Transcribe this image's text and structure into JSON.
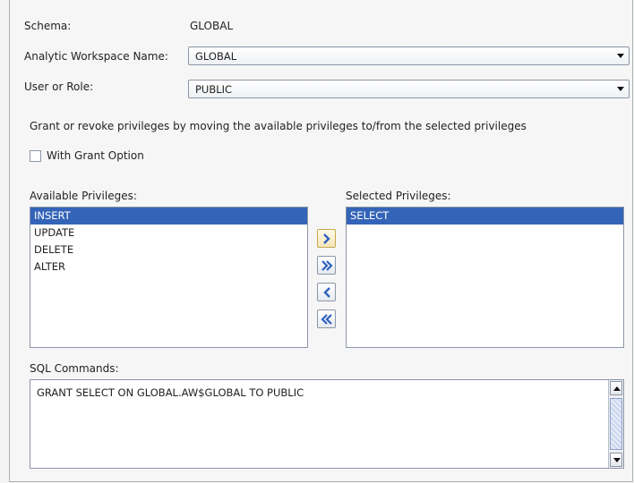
{
  "schema": {
    "label": "Schema:",
    "value": "GLOBAL"
  },
  "aw": {
    "label": "Analytic Workspace Name:",
    "value": "GLOBAL"
  },
  "role": {
    "label": "User or Role:",
    "value": "PUBLIC"
  },
  "instructions": "Grant or revoke privileges by moving the available privileges to/from the selected privileges",
  "grant_option": {
    "label": "With Grant Option",
    "checked": false
  },
  "available": {
    "label": "Available Privileges:",
    "items": [
      "INSERT",
      "UPDATE",
      "DELETE",
      "ALTER"
    ],
    "selected_index": 0
  },
  "selected": {
    "label": "Selected Privileges:",
    "items": [
      "SELECT"
    ],
    "selected_index": 0
  },
  "buttons": [
    {
      "name": "move-right-button",
      "icon": "chevron-right-icon"
    },
    {
      "name": "move-all-right-button",
      "icon": "double-chevron-right-icon"
    },
    {
      "name": "move-left-button",
      "icon": "chevron-left-icon"
    },
    {
      "name": "move-all-left-button",
      "icon": "double-chevron-left-icon"
    }
  ],
  "sql": {
    "label": "SQL Commands:",
    "text": "GRANT SELECT ON GLOBAL.AW$GLOBAL TO PUBLIC"
  }
}
